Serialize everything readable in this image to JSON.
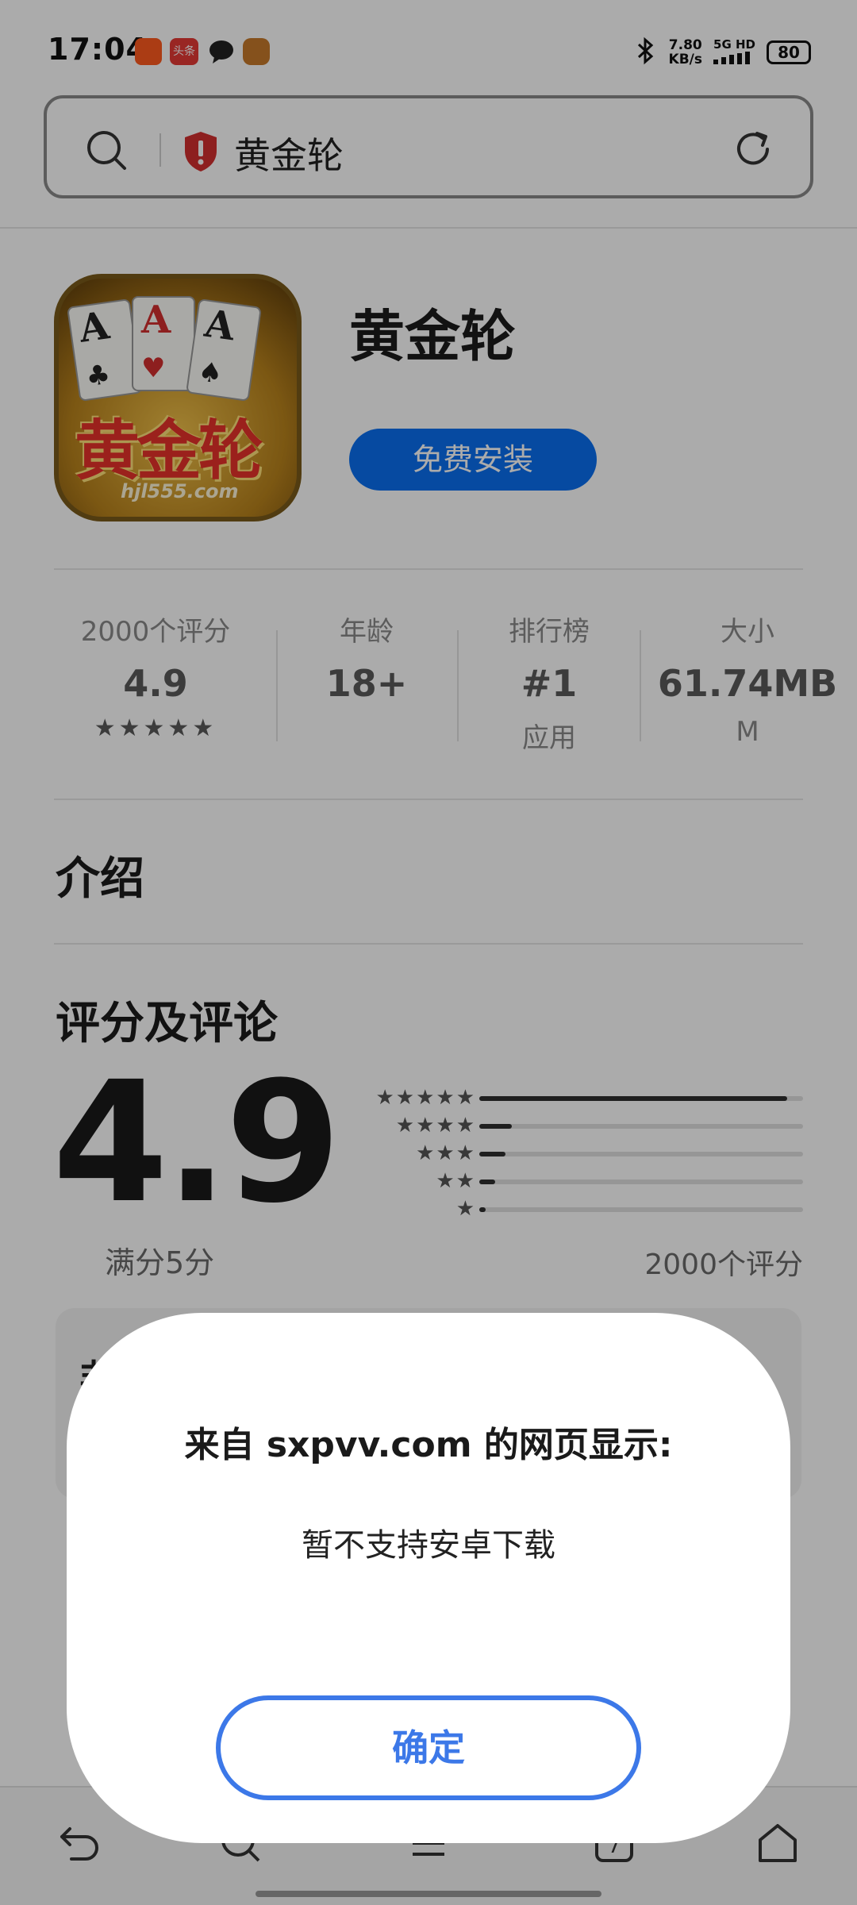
{
  "status_bar": {
    "time": "17:04",
    "notif_badge": "头条",
    "net_speed_value": "7.80",
    "net_speed_unit": "KB/s",
    "network": "5G HD",
    "battery": "80"
  },
  "address_bar": {
    "url_text": "黄金轮"
  },
  "app": {
    "icon_logo_text": "黄金轮",
    "icon_url_text": "hjl555.com",
    "name": "黄金轮",
    "install_label": "免费安装"
  },
  "stats": [
    {
      "label": "2000个评分",
      "value": "4.9",
      "sub": "★★★★★"
    },
    {
      "label": "年龄",
      "value": "18+",
      "sub": ""
    },
    {
      "label": "排行榜",
      "value": "#1",
      "sub": "应用"
    },
    {
      "label": "大小",
      "value": "61.74MB",
      "sub": "M"
    }
  ],
  "sections": {
    "intro": "介绍",
    "ratings": "评分及评论"
  },
  "rating": {
    "score": "4.9",
    "out_of": "满分5分",
    "count": "2000个评分",
    "distribution": [
      {
        "stars": "★★★★★",
        "fraction": 0.95
      },
      {
        "stars": "★★★★",
        "fraction": 0.1
      },
      {
        "stars": "★★★",
        "fraction": 0.08
      },
      {
        "stars": "★★",
        "fraction": 0.05
      },
      {
        "stars": "★",
        "fraction": 0.02
      }
    ]
  },
  "review_card": {
    "title_fragment": "非"
  },
  "dialog": {
    "title": "来自 sxpvv.com 的网页显示:",
    "message": "暂不支持安卓下载",
    "confirm_label": "确定"
  },
  "colors": {
    "accent_blue": "#0a6ff0",
    "dialog_button": "#3c78e8",
    "shield_red": "#d32f2f"
  }
}
